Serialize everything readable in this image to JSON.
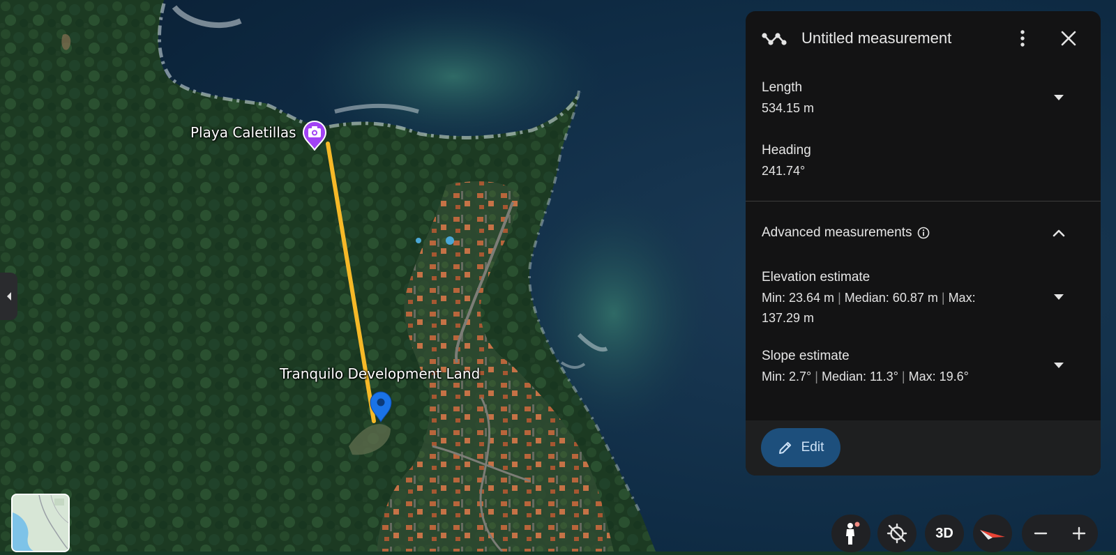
{
  "map": {
    "places": [
      {
        "name": "Playa Caletillas",
        "icon": "camera-icon",
        "color": "#a142f4"
      },
      {
        "name": "Tranquilo Development Land",
        "icon": "location-pin-icon",
        "color": "#1a73e8"
      }
    ],
    "measure_line_color": "#f6b928"
  },
  "panel": {
    "title": "Untitled measurement",
    "length": {
      "label": "Length",
      "value": "534.15 m"
    },
    "heading": {
      "label": "Heading",
      "value": "241.74°"
    },
    "advanced": {
      "label": "Advanced measurements",
      "elevation": {
        "label": "Elevation estimate",
        "min": "Min: 23.64 m",
        "median": "Median: 60.87 m",
        "max_label": "Max:",
        "max_value": "137.29 m"
      },
      "slope": {
        "label": "Slope estimate",
        "min": "Min: 2.7°",
        "median": "Median: 11.3°",
        "max": "Max: 19.6°"
      }
    },
    "separator": "|",
    "edit_label": "Edit"
  },
  "controls": {
    "view_3d_label": "3D",
    "accent_color": "#1d4f7c"
  }
}
